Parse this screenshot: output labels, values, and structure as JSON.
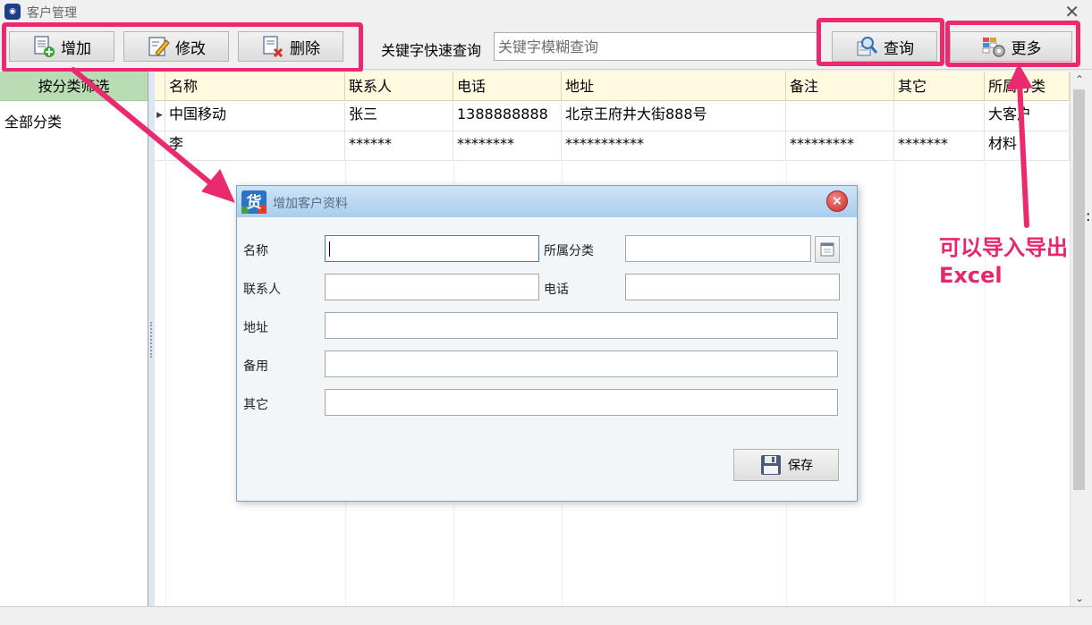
{
  "window": {
    "title": "客户管理",
    "close_glyph": "✕"
  },
  "toolbar": {
    "add_label": "增加",
    "edit_label": "修改",
    "delete_label": "删除",
    "keyword_label": "关键字快速查询",
    "keyword_placeholder": "关键字模糊查询",
    "search_label": "查询",
    "more_label": "更多"
  },
  "sidebar": {
    "header": "按分类筛选",
    "items": [
      {
        "label": "全部分类"
      }
    ]
  },
  "grid": {
    "columns": [
      "名称",
      "联系人",
      "电话",
      "地址",
      "备注",
      "其它",
      "所属分类"
    ],
    "rows": [
      {
        "current": true,
        "cells": [
          "中国移动",
          "张三",
          "1388888888",
          "北京王府井大街888号",
          "",
          "",
          "大客户"
        ]
      },
      {
        "current": false,
        "cells": [
          "李",
          "******",
          "********",
          "***********",
          "*********",
          "*******",
          "材料"
        ]
      }
    ]
  },
  "scrollbar": {
    "up_glyph": "⌃",
    "down_glyph": "⌄"
  },
  "dialog": {
    "title": "增加客户资料",
    "icon_char": "货",
    "close_glyph": "×",
    "fields": {
      "name": {
        "label": "名称",
        "value": ""
      },
      "category": {
        "label": "所属分类",
        "value": ""
      },
      "contact": {
        "label": "联系人",
        "value": ""
      },
      "phone": {
        "label": "电话",
        "value": ""
      },
      "address": {
        "label": "地址",
        "value": ""
      },
      "remark": {
        "label": "备用",
        "value": ""
      },
      "other": {
        "label": "其它",
        "value": ""
      }
    },
    "save_label": "保存"
  },
  "annotation": {
    "line1": "可以导入导出",
    "line2": "Excel"
  },
  "edge_glyph": ":",
  "colors": {
    "highlight": "#ea2a6e",
    "category_header": "#b9dcb4",
    "grid_header": "#fff9e0",
    "dialog_title": "#a9cdee"
  }
}
